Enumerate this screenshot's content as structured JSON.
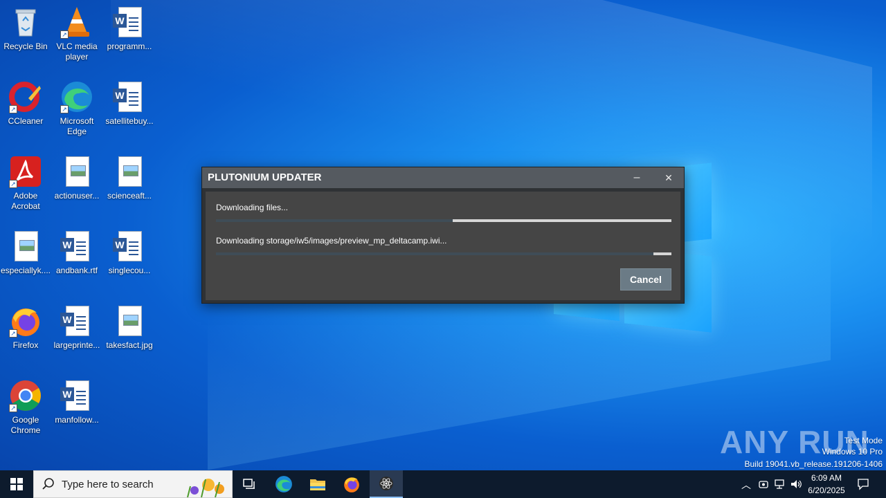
{
  "desktop": {
    "icons": [
      {
        "label": "Recycle Bin"
      },
      {
        "label": "VLC media player"
      },
      {
        "label": "programm..."
      },
      {
        "label": "CCleaner"
      },
      {
        "label": "Microsoft Edge"
      },
      {
        "label": "satellitebuy..."
      },
      {
        "label": "Adobe Acrobat"
      },
      {
        "label": "actionuser..."
      },
      {
        "label": "scienceaft..."
      },
      {
        "label": "especiallyk...."
      },
      {
        "label": "andbank.rtf"
      },
      {
        "label": "singlecou..."
      },
      {
        "label": "Firefox"
      },
      {
        "label": "largeprinte..."
      },
      {
        "label": "takesfact.jpg"
      },
      {
        "label": "Google Chrome"
      },
      {
        "label": "manfollow..."
      }
    ]
  },
  "dialog": {
    "title": "PLUTONIUM UPDATER",
    "minimize_glyph": "–",
    "close_glyph": "✕",
    "status_main": "Downloading files...",
    "progress_main": 0.48,
    "status_file": "Downloading storage/iw5/images/preview_mp_deltacamp.iwi...",
    "progress_file": 0.96,
    "cancel_label": "Cancel"
  },
  "watermark": {
    "brand": "ANY RUN",
    "line1": "Test Mode",
    "line2": "Windows 10 Pro",
    "line3": "Build 19041.vb_release.191206-1406"
  },
  "taskbar": {
    "search_placeholder": "Type here to search",
    "time": "6:09 AM",
    "date": "6/20/2025"
  },
  "colors": {
    "dialog_title_bg": "#555a60",
    "dialog_body_bg": "#454545",
    "progress_fill": "#d6d6d6",
    "progress_track": "#3f4d57",
    "cancel_bg": "#6b7b86",
    "taskbar_bg": "#0d1b2d"
  }
}
